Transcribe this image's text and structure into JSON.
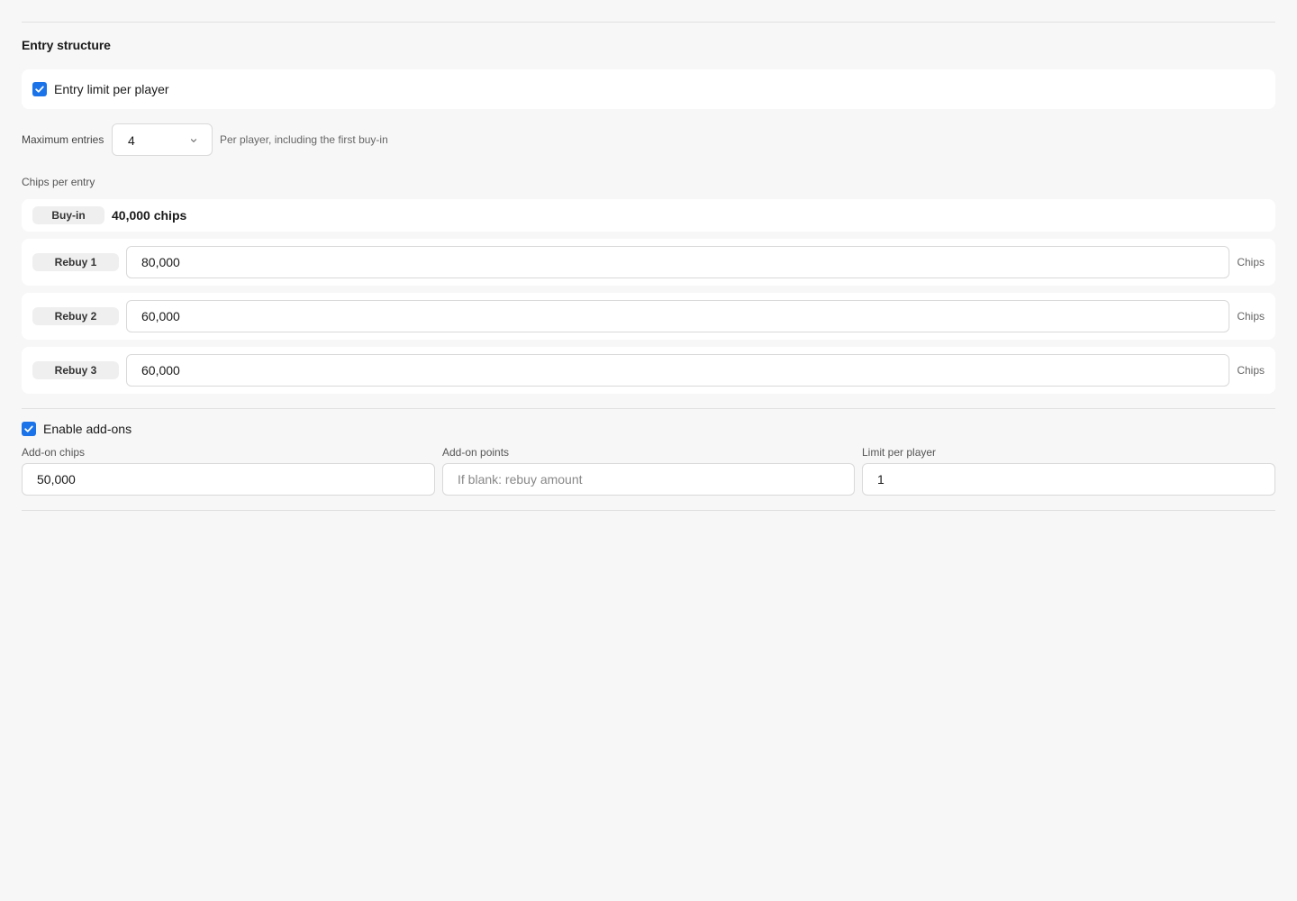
{
  "entry_structure": {
    "title": "Entry structure",
    "entry_limit": {
      "label": "Entry limit per player",
      "checked": true
    },
    "maximum_entries": {
      "label": "Maximum entries",
      "value": "4",
      "hint": "Per player, including the first buy-in"
    },
    "chips_per_entry": {
      "label": "Chips per entry",
      "buyin": {
        "label": "Buy-in",
        "value": "40,000 chips"
      },
      "rebuys": [
        {
          "label": "Rebuy 1",
          "value": "80,000",
          "unit": "Chips"
        },
        {
          "label": "Rebuy 2",
          "value": "60,000",
          "unit": "Chips"
        },
        {
          "label": "Rebuy 3",
          "value": "60,000",
          "unit": "Chips"
        }
      ]
    }
  },
  "addons": {
    "enable": {
      "label": "Enable add-ons",
      "checked": true
    },
    "chips": {
      "label": "Add-on chips",
      "value": "50,000"
    },
    "points": {
      "label": "Add-on points",
      "value": "",
      "placeholder": "If blank: rebuy amount"
    },
    "limit": {
      "label": "Limit per player",
      "value": "1"
    }
  },
  "colors": {
    "accent": "#1a73e8",
    "background": "#f7f7f7",
    "card": "#ffffff",
    "border": "#d9d9d9"
  },
  "icons": {
    "checkbox": "check-icon",
    "select": "chevron-down-icon"
  }
}
